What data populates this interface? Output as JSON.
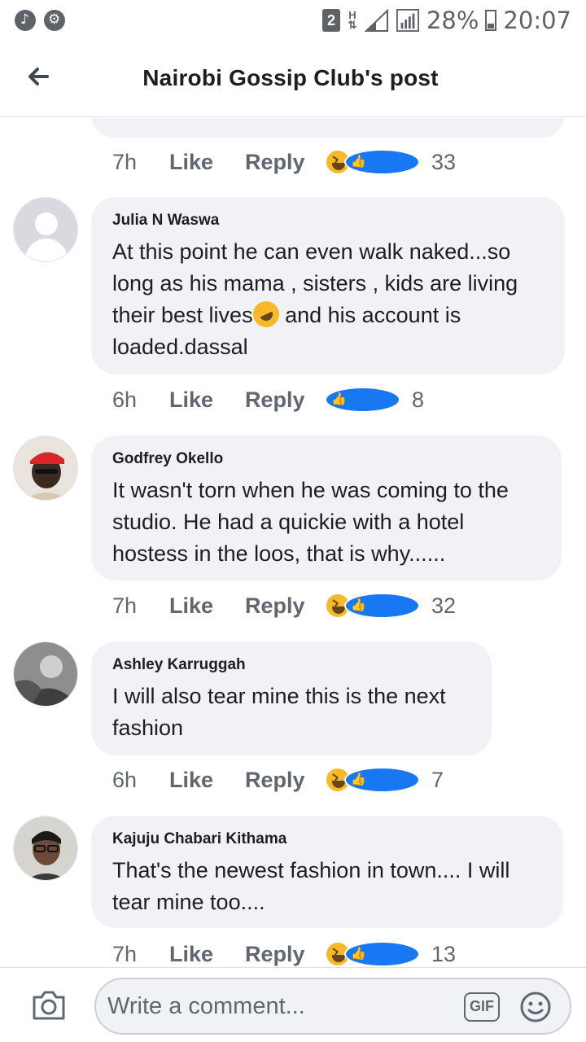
{
  "status_bar": {
    "sim_slot": "2",
    "network": "H",
    "battery": "28%",
    "time": "20:07"
  },
  "header": {
    "title": "Nairobi Gossip Club's post"
  },
  "previous_comment": {
    "time": "7h",
    "like_label": "Like",
    "reply_label": "Reply",
    "reactions": [
      "haha",
      "like"
    ],
    "reaction_count": "33"
  },
  "comments": [
    {
      "author": "Julia N Waswa",
      "text_before_emoji": "At this point he can even walk naked...so long as his mama , sisters , kids are living their best lives",
      "text_after_emoji": " and his account is loaded.dassal",
      "time": "6h",
      "like_label": "Like",
      "reply_label": "Reply",
      "reactions": [
        "like"
      ],
      "reaction_count": "8"
    },
    {
      "author": "Godfrey Okello",
      "text": "It wasn't torn when he was coming to the studio. He had a quickie with a hotel hostess in the loos, that is why......",
      "time": "7h",
      "like_label": "Like",
      "reply_label": "Reply",
      "reactions": [
        "haha",
        "like"
      ],
      "reaction_count": "32"
    },
    {
      "author": "Ashley Karruggah",
      "text": "I will also tear mine this is the next fashion",
      "time": "6h",
      "like_label": "Like",
      "reply_label": "Reply",
      "reactions": [
        "haha",
        "like"
      ],
      "reaction_count": "7"
    },
    {
      "author": "Kajuju Chabari Kithama",
      "text": "That's the newest fashion in town.... I will tear mine too....",
      "time": "7h",
      "like_label": "Like",
      "reply_label": "Reply",
      "reactions": [
        "haha",
        "like"
      ],
      "reaction_count": "13"
    }
  ],
  "composer": {
    "placeholder": "Write a comment...",
    "gif_label": "GIF"
  }
}
